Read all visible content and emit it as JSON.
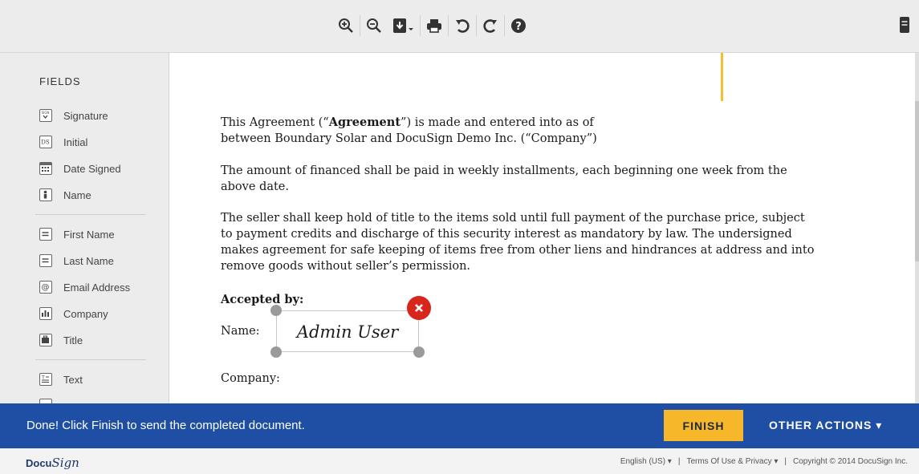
{
  "toolbar": {
    "buttons": [
      "zoom-in-icon",
      "zoom-out-icon",
      "download-icon",
      "print-icon",
      "rotate-left-icon",
      "rotate-right-icon",
      "help-icon"
    ]
  },
  "sidebar": {
    "title": "FIELDS",
    "fields_group1": [
      {
        "label": "Signature",
        "icon": "signature-icon"
      },
      {
        "label": "Initial",
        "icon": "initial-icon"
      },
      {
        "label": "Date Signed",
        "icon": "date-signed-icon"
      },
      {
        "label": "Name",
        "icon": "name-icon"
      }
    ],
    "fields_group2": [
      {
        "label": "First Name",
        "icon": "first-name-icon"
      },
      {
        "label": "Last Name",
        "icon": "last-name-icon"
      },
      {
        "label": "Email Address",
        "icon": "email-icon"
      },
      {
        "label": "Company",
        "icon": "company-icon"
      },
      {
        "label": "Title",
        "icon": "title-icon"
      }
    ],
    "fields_group3": [
      {
        "label": "Text",
        "icon": "text-icon"
      }
    ]
  },
  "document": {
    "p1_pre": "This Agreement (“",
    "p1_bold": "Agreement",
    "p1_post": "”) is made and entered into as of",
    "p1_line2": "between Boundary Solar and DocuSign Demo Inc. (“Company”)",
    "p2": "The amount of financed shall be paid in weekly installments, each beginning one week from the above date.",
    "p3": "The seller shall keep hold of title to the items sold until full payment of the purchase price, subject to payment credits and discharge of this security interest as mandatory by law. The undersigned makes agreement for safe keeping of items free from other liens and hindrances at address and into remove goods without seller’s permission.",
    "accepted_by": "Accepted by:",
    "name_label": "Name:",
    "signature_value": "Admin User",
    "company_label": "Company:"
  },
  "actionbar": {
    "message": "Done! Click Finish to send the completed document.",
    "finish_label": "FINISH",
    "other_actions_label": "OTHER ACTIONS ▾"
  },
  "footer": {
    "logo_prefix": "Docu",
    "logo_script": "Sign",
    "language": "English (US) ▾",
    "terms": "Terms Of Use & Privacy ▾",
    "copyright": "Copyright © 2014 DocuSign Inc.",
    "separator": "|"
  },
  "colors": {
    "actionbar": "#1f4fa4",
    "finish": "#f6b72a",
    "close": "#d9261c",
    "cursor": "#f5bd31"
  }
}
